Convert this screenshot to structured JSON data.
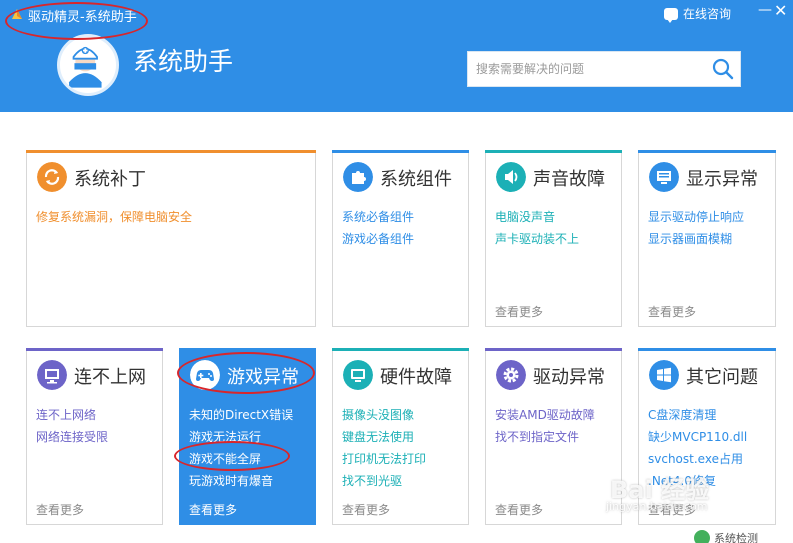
{
  "window": {
    "title": "驱动精灵-系统助手",
    "consult_label": "在线咨询",
    "minimize_glyph": "—",
    "close_glyph": "✕"
  },
  "header": {
    "app_title": "系统助手",
    "search_placeholder": "搜索需要解决的问题",
    "icons": [
      "app-logo-icon",
      "chat-bubble-icon",
      "doctor-avatar-icon",
      "search-icon"
    ]
  },
  "colors": {
    "header_bg": "#2f8ee6",
    "orange": "#f08f2e",
    "blue": "#2f8ee6",
    "teal": "#1cb0b6",
    "purple": "#6d64c8",
    "annotation": "#d8262b"
  },
  "cards": [
    {
      "title": "系统补丁",
      "icon": "refresh-icon",
      "links": [
        "修复系统漏洞，保障电脑安全"
      ],
      "more": ""
    },
    {
      "title": "系统组件",
      "icon": "puzzle-icon",
      "links": [
        "系统必备组件",
        "游戏必备组件"
      ],
      "more": ""
    },
    {
      "title": "声音故障",
      "icon": "speaker-icon",
      "links": [
        "电脑没声音",
        "声卡驱动装不上"
      ],
      "more": "查看更多"
    },
    {
      "title": "显示异常",
      "icon": "monitor-icon",
      "links": [
        "显示驱动停止响应",
        "显示器画面模糊"
      ],
      "more": "查看更多"
    },
    {
      "title": "连不上网",
      "icon": "network-icon",
      "links": [
        "连不上网络",
        "网络连接受限"
      ],
      "more": "查看更多"
    },
    {
      "title": "游戏异常",
      "icon": "gamepad-icon",
      "links": [
        "未知的DirectX错误",
        "游戏无法运行",
        "游戏不能全屏",
        "玩游戏时有爆音"
      ],
      "more": "查看更多"
    },
    {
      "title": "硬件故障",
      "icon": "hardware-icon",
      "links": [
        "摄像头没图像",
        "键盘无法使用",
        "打印机无法打印",
        "找不到光驱"
      ],
      "more": "查看更多"
    },
    {
      "title": "驱动异常",
      "icon": "gear-icon",
      "links": [
        "安装AMD驱动故障",
        "找不到指定文件"
      ],
      "more": "查看更多"
    },
    {
      "title": "其它问题",
      "icon": "windows-icon",
      "links": [
        "C盘深度清理",
        "缺少MVCP110.dll",
        "svchost.exe占用",
        ".Net4.0修复"
      ],
      "more": "查看更多"
    }
  ],
  "watermark": {
    "main": "Bai 经验",
    "sub": "jingyan.baidu.com"
  },
  "status": {
    "label": "系统检测"
  }
}
